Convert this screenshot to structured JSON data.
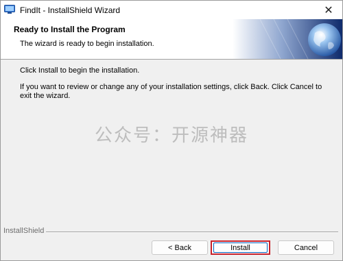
{
  "window": {
    "title": "FindIt - InstallShield Wizard",
    "close_glyph": "✕"
  },
  "header": {
    "title": "Ready to Install the Program",
    "subtitle": "The wizard is ready to begin installation."
  },
  "content": {
    "line1": "Click Install to begin the installation.",
    "line2": "If you want to review or change any of your installation settings, click Back. Click Cancel to exit the wizard."
  },
  "watermark": "公众号：开源神器",
  "footer": {
    "brand": "InstallShield"
  },
  "buttons": {
    "back": "< Back",
    "install": "Install",
    "cancel": "Cancel"
  },
  "colors": {
    "highlight_border": "#c8202a",
    "focus_border": "#0060c0",
    "banner_dark": "#0e2a6b"
  },
  "icons": {
    "app": "installer-icon",
    "banner": "globe-icon",
    "close": "close-icon"
  }
}
